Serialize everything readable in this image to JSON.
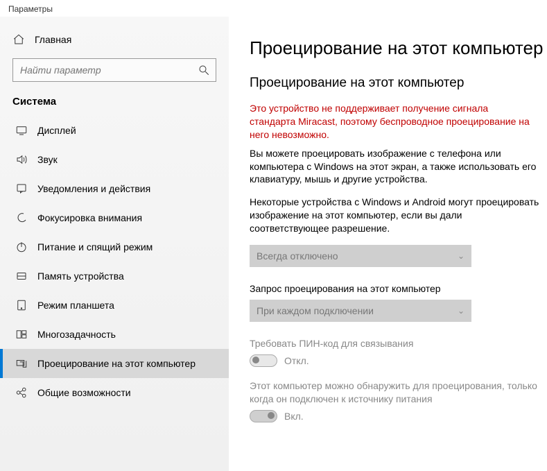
{
  "window": {
    "title": "Параметры"
  },
  "sidebar": {
    "home": "Главная",
    "search_placeholder": "Найти параметр",
    "category": "Система",
    "items": [
      {
        "label": "Дисплей",
        "icon": "display"
      },
      {
        "label": "Звук",
        "icon": "sound"
      },
      {
        "label": "Уведомления и действия",
        "icon": "notifications"
      },
      {
        "label": "Фокусировка внимания",
        "icon": "focus"
      },
      {
        "label": "Питание и спящий режим",
        "icon": "power"
      },
      {
        "label": "Память устройства",
        "icon": "storage"
      },
      {
        "label": "Режим планшета",
        "icon": "tablet"
      },
      {
        "label": "Многозадачность",
        "icon": "multitask"
      },
      {
        "label": "Проецирование на этот компьютер",
        "icon": "project",
        "selected": true
      },
      {
        "label": "Общие возможности",
        "icon": "shared"
      }
    ]
  },
  "content": {
    "page_title": "Проецирование на этот компьютер",
    "section_title": "Проецирование на этот компьютер",
    "warning": "Это устройство не поддерживает получение сигнала стандарта Miracast, поэтому беспроводное проецирование на него невозможно.",
    "para1": "Вы можете проецировать изображение с телефона или компьютера с Windows на этот экран, а также использовать его клавиатуру, мышь и другие устройства.",
    "para2": "Некоторые устройства с Windows и Android могут проецировать изображение на этот компьютер, если вы дали соответствующее разрешение.",
    "dropdown1_value": "Всегда отключено",
    "label2": "Запрос проецирования на этот компьютер",
    "dropdown2_value": "При каждом подключении",
    "label3": "Требовать ПИН-код для связывания",
    "toggle3_state": "Откл.",
    "label4": "Этот компьютер можно обнаружить для проецирования, только когда он подключен к источнику питания",
    "toggle4_state": "Вкл."
  }
}
